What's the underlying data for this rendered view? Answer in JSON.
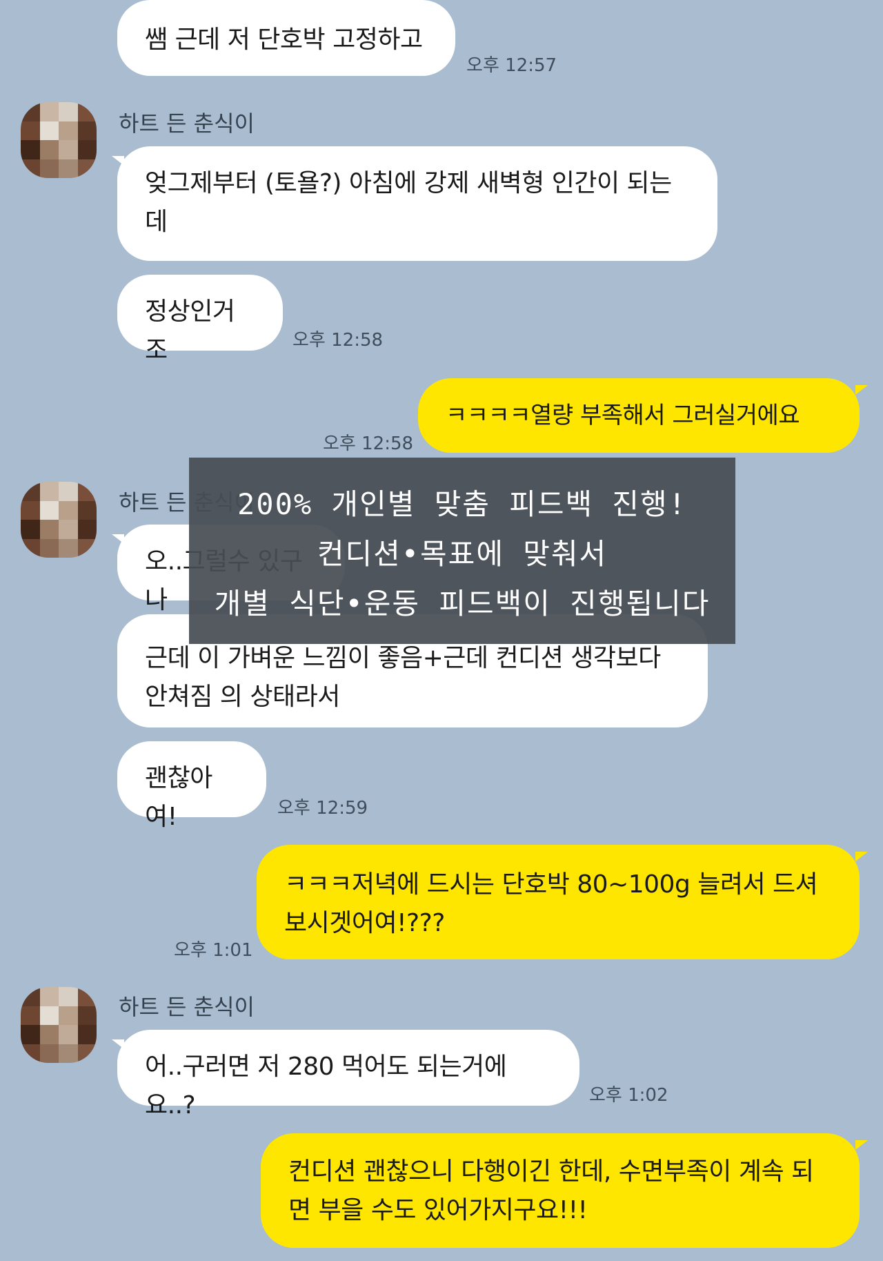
{
  "theme": {
    "background": "#a9bcd0",
    "incoming_bubble": "#ffffff",
    "outgoing_bubble": "#fee600",
    "overlay": "#484e54"
  },
  "sender_name": "하트 든 춘식이",
  "messages": [
    {
      "dir": "in",
      "text": "쌤 근데 저 단호박 고정하고",
      "time": "오후 12:57"
    },
    {
      "dir": "in",
      "text": "엊그제부터 (토욜?) 아침에 강제 새벽형 인간이 되는데"
    },
    {
      "dir": "in",
      "text": "정상인거조",
      "time": "오후 12:58"
    },
    {
      "dir": "out",
      "text": "ㅋㅋㅋㅋ열량 부족해서 그러실거에요",
      "time": "오후 12:58"
    },
    {
      "dir": "in",
      "text": "오..그럴수 있구나"
    },
    {
      "dir": "in",
      "text": "근데 이 가벼운 느낌이 좋음+근데 컨디션 생각보다 안쳐짐 의 상태라서"
    },
    {
      "dir": "in",
      "text": "괜찮아여!",
      "time": "오후 12:59"
    },
    {
      "dir": "out",
      "text": "ㅋㅋㅋ저녁에 드시는 단호박 80~100g 늘려서 드셔보시겟어여!???",
      "time": "오후 1:01"
    },
    {
      "dir": "in",
      "text": "어..구러면 저 280 먹어도 되는거에요..?",
      "time": "오후 1:02"
    },
    {
      "dir": "out",
      "text": "컨디션 괜찮으니 다행이긴 한데, 수면부족이 계속 되면 부을 수도 있어가지구요!!!"
    }
  ],
  "overlay": {
    "line1": "200% 개인별 맞춤 피드백 진행!",
    "line2": "컨디션•목표에 맞춰서",
    "line3": "개별 식단•운동 피드백이 진행됩니다"
  }
}
